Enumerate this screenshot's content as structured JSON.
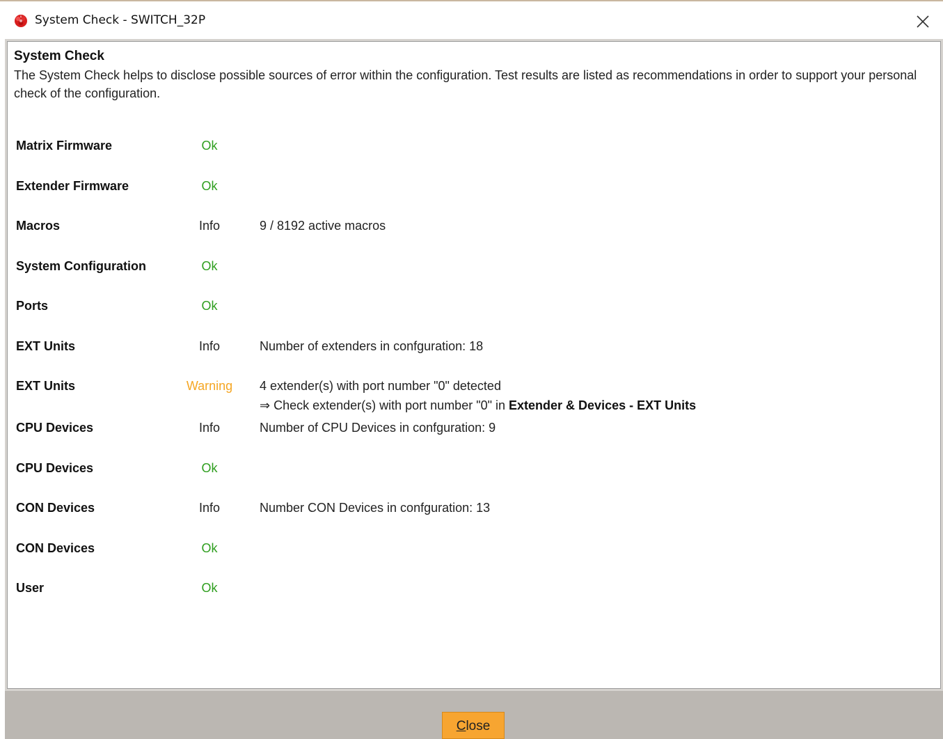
{
  "window": {
    "title": "System Check - SWITCH_32P"
  },
  "header": {
    "title": "System Check",
    "description": "The System Check helps to disclose possible sources of error within the configuration. Test results are listed as recommendations in order to support your personal check of the configuration."
  },
  "rows": [
    {
      "name": "Matrix Firmware",
      "status": "Ok",
      "message": ""
    },
    {
      "name": "Extender Firmware",
      "status": "Ok",
      "message": ""
    },
    {
      "name": "Macros",
      "status": "Info",
      "message": "9 / 8192 active macros"
    },
    {
      "name": "System Configuration",
      "status": "Ok",
      "message": ""
    },
    {
      "name": "Ports",
      "status": "Ok",
      "message": ""
    },
    {
      "name": "EXT Units",
      "status": "Info",
      "message": "Number of extenders in confguration: 18"
    },
    {
      "name": "EXT Units",
      "status": "Warning",
      "message": "4 extender(s) with port number \"0\" detected",
      "hint_prefix": "⇒ Check extender(s) with port number \"0\" in ",
      "hint_bold": "Extender & Devices - EXT Units"
    },
    {
      "name": "CPU Devices",
      "status": "Info",
      "message": "Number of CPU Devices in confguration: 9"
    },
    {
      "name": "CPU Devices",
      "status": "Ok",
      "message": ""
    },
    {
      "name": "CON Devices",
      "status": "Info",
      "message": "Number CON Devices in confguration: 13"
    },
    {
      "name": "CON Devices",
      "status": "Ok",
      "message": ""
    },
    {
      "name": "User",
      "status": "Ok",
      "message": ""
    }
  ],
  "footer": {
    "close_label_mnemonic": "C",
    "close_label_rest": "lose"
  },
  "colors": {
    "ok": "#2e9e1e",
    "warning": "#f5a623",
    "button": "#f7a531",
    "footer": "#bbb7b2"
  },
  "icons": {
    "app": "app-logo-icon",
    "close": "close-icon"
  }
}
